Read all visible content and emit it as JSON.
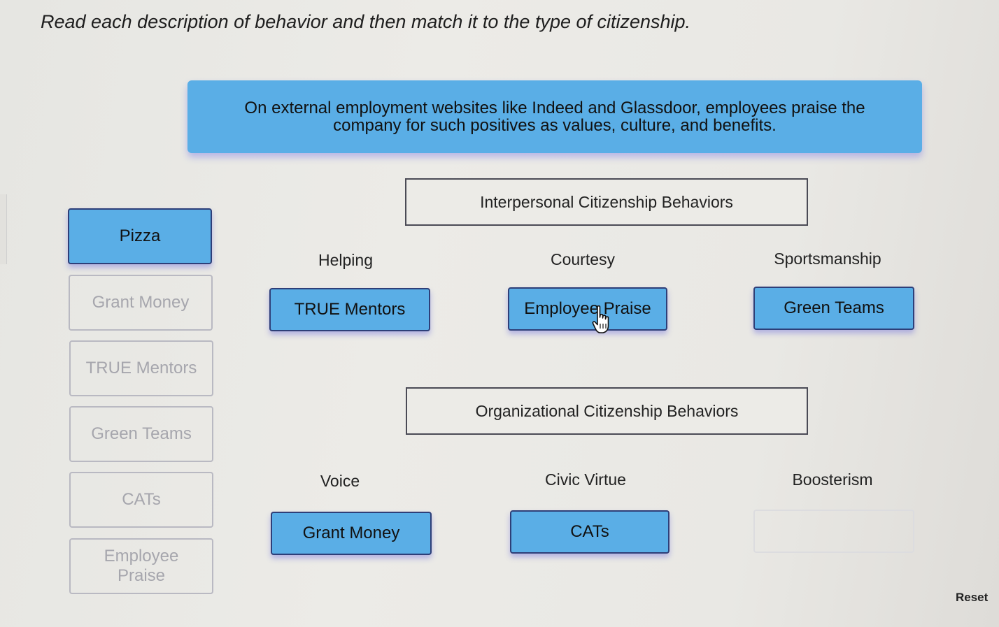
{
  "instructions": "Read each description of behavior and then match it to the type of citizenship.",
  "prompt": "On external employment websites like Indeed and Glassdoor, employees praise the company for such positives as values, culture, and benefits.",
  "word_bank": [
    {
      "label": "Pizza",
      "state": "available"
    },
    {
      "label": "Grant Money",
      "state": "used"
    },
    {
      "label": "TRUE Mentors",
      "state": "used"
    },
    {
      "label": "Green Teams",
      "state": "used"
    },
    {
      "label": "CATs",
      "state": "used"
    },
    {
      "label": "Employee Praise",
      "state": "used"
    }
  ],
  "categories": [
    {
      "title": "Interpersonal Citizenship Behaviors",
      "slots": [
        {
          "label": "Helping",
          "value": "TRUE Mentors"
        },
        {
          "label": "Courtesy",
          "value": "Employee Praise"
        },
        {
          "label": "Sportsmanship",
          "value": "Green Teams"
        }
      ]
    },
    {
      "title": "Organizational Citizenship Behaviors",
      "slots": [
        {
          "label": "Voice",
          "value": "Grant Money"
        },
        {
          "label": "Civic Virtue",
          "value": "CATs"
        },
        {
          "label": "Boosterism",
          "value": ""
        }
      ]
    }
  ],
  "footer_partial_text": "Reset",
  "colors": {
    "card_fill": "#5aaee6",
    "card_border": "#2e3f78",
    "used_border": "#b9b9c2",
    "used_text": "#a6a6ad"
  },
  "icons": {
    "cursor": "hand-pointer-icon"
  }
}
